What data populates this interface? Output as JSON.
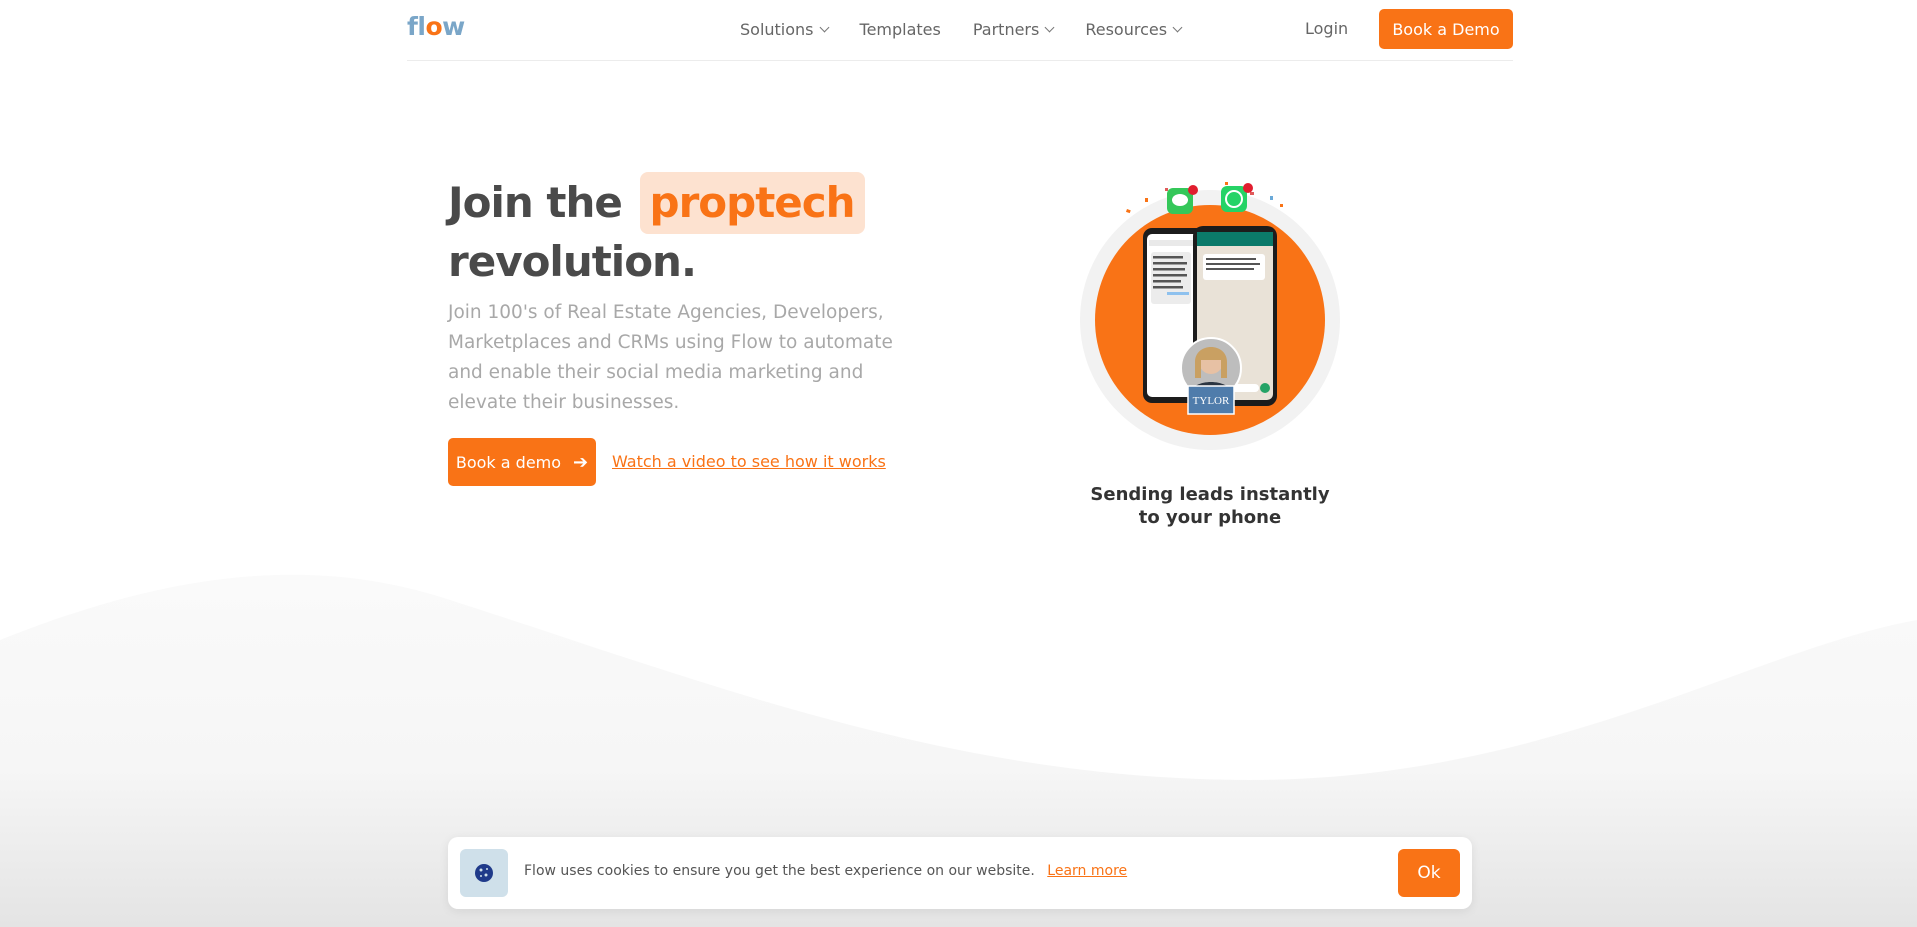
{
  "header": {
    "logo": "flow",
    "nav": [
      {
        "label": "Solutions",
        "has_dropdown": true
      },
      {
        "label": "Templates",
        "has_dropdown": false
      },
      {
        "label": "Partners",
        "has_dropdown": true
      },
      {
        "label": "Resources",
        "has_dropdown": true
      }
    ],
    "login_label": "Login",
    "demo_label": "Book a Demo"
  },
  "hero": {
    "title_prefix": "Join the",
    "title_highlight": "proptech",
    "title_suffix": "revolution.",
    "subtitle": "Join 100's of Real Estate Agencies, Developers, Marketplaces and CRMs using Flow to automate and enable their social media marketing and elevate their businesses.",
    "cta_label": "Book a demo",
    "video_link": "Watch a video to see how it works"
  },
  "illustration": {
    "caption": "Sending leads instantly to your phone",
    "badge": "TYLOR"
  },
  "cookie": {
    "text": "Flow uses cookies to ensure you get the best experience on our website.",
    "learn_more": "Learn more",
    "ok_label": "Ok"
  },
  "colors": {
    "accent": "#f97316",
    "highlight_bg": "#fde2d0",
    "logo_blue": "#7aa6c8"
  }
}
